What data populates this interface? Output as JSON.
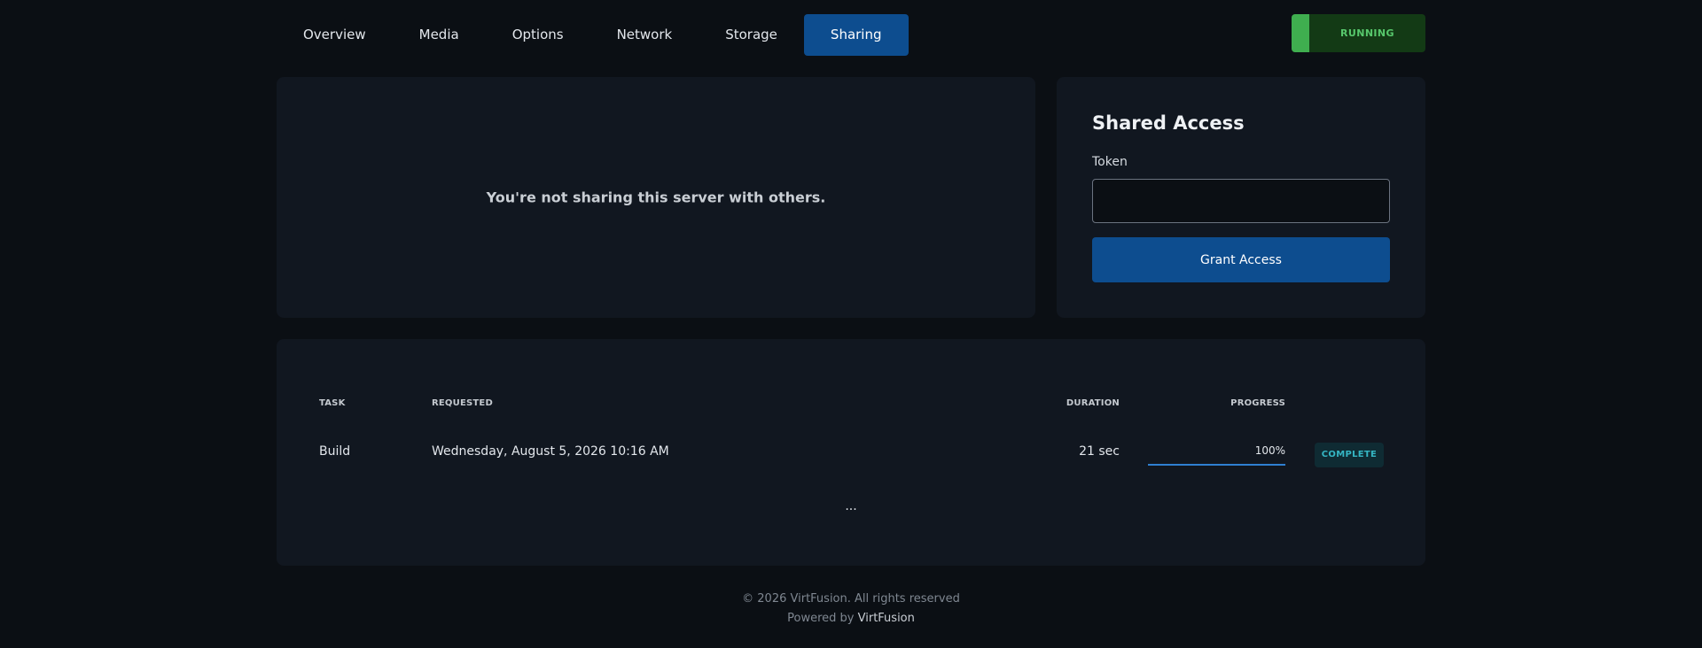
{
  "nav": {
    "tabs": [
      {
        "label": "Overview"
      },
      {
        "label": "Media"
      },
      {
        "label": "Options"
      },
      {
        "label": "Network"
      },
      {
        "label": "Storage"
      },
      {
        "label": "Sharing"
      }
    ],
    "active_tab": "Sharing"
  },
  "status": {
    "label": "RUNNING",
    "color": "#3fae4f"
  },
  "sharing": {
    "empty_message": "You're not sharing this server with others."
  },
  "shared_access": {
    "title": "Shared Access",
    "token_label": "Token",
    "token_value": "",
    "grant_label": "Grant Access"
  },
  "tasks": {
    "headers": {
      "task": "TASK",
      "requested": "REQUESTED",
      "duration": "DURATION",
      "progress": "PROGRESS"
    },
    "rows": [
      {
        "task": "Build",
        "requested": "Wednesday, August 5, 2026 10:16 AM",
        "duration": "21 sec",
        "progress_label": "100%",
        "progress_percent": 100,
        "status": "COMPLETE"
      }
    ],
    "more_label": "..."
  },
  "footer": {
    "copyright": "© 2026 VirtFusion. All rights reserved",
    "powered_by_prefix": "Powered by",
    "powered_by_brand": "VirtFusion"
  },
  "colors": {
    "accent": "#0d4d8f",
    "background": "#0b0f14",
    "card": "#111720",
    "running": "#3fae4f",
    "complete": "#35b6c4"
  }
}
